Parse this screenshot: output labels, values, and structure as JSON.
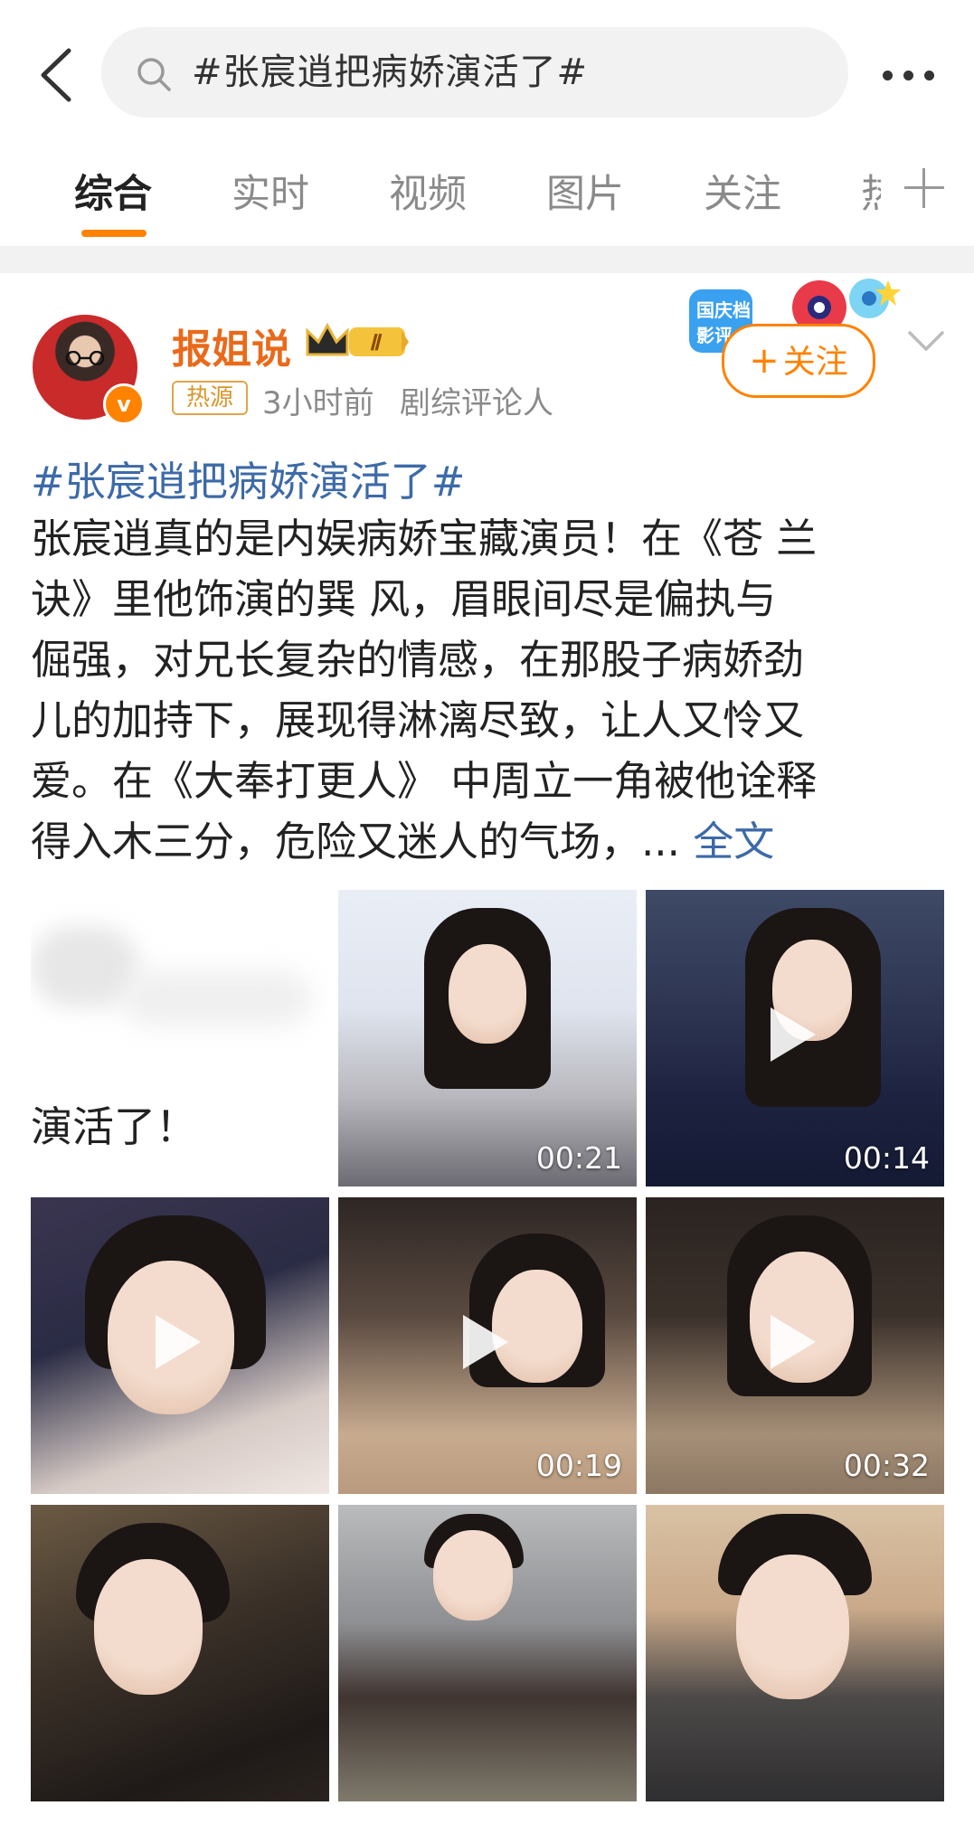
{
  "search": {
    "query": "#张宸逍把病娇演活了#"
  },
  "tabs": [
    "综合",
    "实时",
    "视频",
    "图片",
    "关注",
    "热"
  ],
  "post": {
    "author": "报姐说",
    "level_badge": "Ⅱ",
    "tag": "热源",
    "time": "3小时前",
    "role": "剧综评论人",
    "follow_label": "关注",
    "follow_plus": "+",
    "promo_text": "国庆档 影评",
    "hashtag": "#张宸逍把病娇演活了#",
    "body_lines": [
      "张宸逍真的是内娱病娇宝藏演员！在《苍 兰",
      "诀》里他饰演的巽 风，眉眼间尽是偏执与",
      "倔强，对兄长复杂的情感，在那股子病娇劲",
      "儿的加持下，展现得淋漓尽致，让人又怜又",
      "爱。在《大奉打更人》 中周立一角被他诠释",
      "得入木三分，危险又迷人的气场，... "
    ],
    "full_text_link": "全文"
  },
  "media": [
    {
      "type": "text-card",
      "caption": "演活了！"
    },
    {
      "type": "image",
      "duration": "00:21"
    },
    {
      "type": "video",
      "duration": "00:14"
    },
    {
      "type": "video",
      "duration": ""
    },
    {
      "type": "video",
      "duration": "00:19"
    },
    {
      "type": "video",
      "duration": "00:32"
    },
    {
      "type": "image",
      "duration": ""
    },
    {
      "type": "image",
      "duration": ""
    },
    {
      "type": "image",
      "duration": ""
    }
  ],
  "colors": {
    "accent": "#ff8200",
    "username": "#e86a1a",
    "link": "#3d6aa8",
    "muted": "#8a8a8a"
  }
}
